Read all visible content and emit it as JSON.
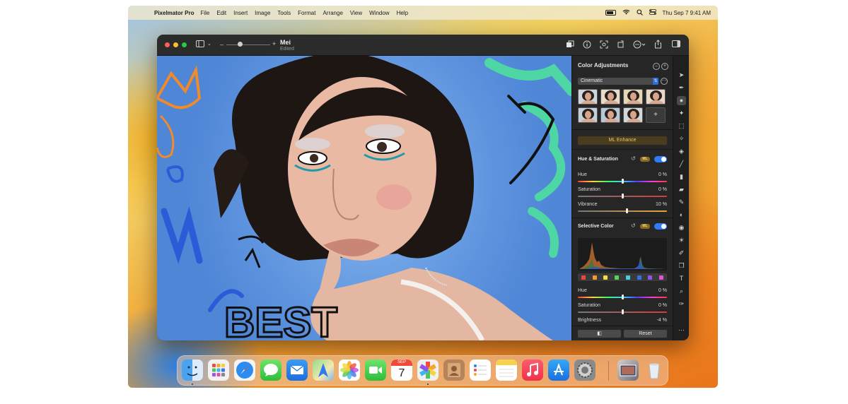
{
  "menubar": {
    "app_name": "Pixelmator Pro",
    "menus": [
      "File",
      "Edit",
      "Insert",
      "Image",
      "Tools",
      "Format",
      "Arrange",
      "View",
      "Window",
      "Help"
    ],
    "datetime": "Thu Sep 7  9:41 AM"
  },
  "window": {
    "doc_title": "Mei",
    "doc_subtitle": "Edited",
    "zoom_minus": "–",
    "zoom_plus": "+"
  },
  "panel": {
    "title": "Color Adjustments",
    "preset": "Cinematic",
    "ml_enhance": "ML Enhance",
    "hue_saturation": {
      "title": "Hue & Saturation",
      "badge": "ML",
      "enabled": true,
      "sliders": [
        {
          "label": "Hue",
          "value": "0 %",
          "position": 0.5
        },
        {
          "label": "Saturation",
          "value": "0 %",
          "position": 0.5
        },
        {
          "label": "Vibrance",
          "value": "10 %",
          "position": 0.55
        }
      ]
    },
    "selective_color": {
      "title": "Selective Color",
      "badge": "ML",
      "enabled": true,
      "swatch_colors": [
        "#e8473c",
        "#f19a36",
        "#f0dc4b",
        "#57d25a",
        "#3fd4e0",
        "#3a6ef0",
        "#8e56e8",
        "#e453d2"
      ],
      "sliders": [
        {
          "label": "Hue",
          "value": "0 %",
          "position": 0.5
        },
        {
          "label": "Saturation",
          "value": "0 %",
          "position": 0.5
        },
        {
          "label": "Brightness",
          "value": "-4 %",
          "position": 0.48
        }
      ]
    },
    "compare_label": "◧",
    "reset_label": "Reset"
  },
  "canvas_text": {
    "best": "BEST"
  },
  "dock": {
    "apps": [
      "finder",
      "launchpad",
      "safari",
      "messages",
      "mail",
      "maps",
      "photos",
      "facetime",
      "calendar",
      "pixelmator-pro",
      "contacts",
      "reminders",
      "notes",
      "music",
      "app-store",
      "system-settings"
    ],
    "calendar_month": "SEP",
    "calendar_day": "7"
  }
}
